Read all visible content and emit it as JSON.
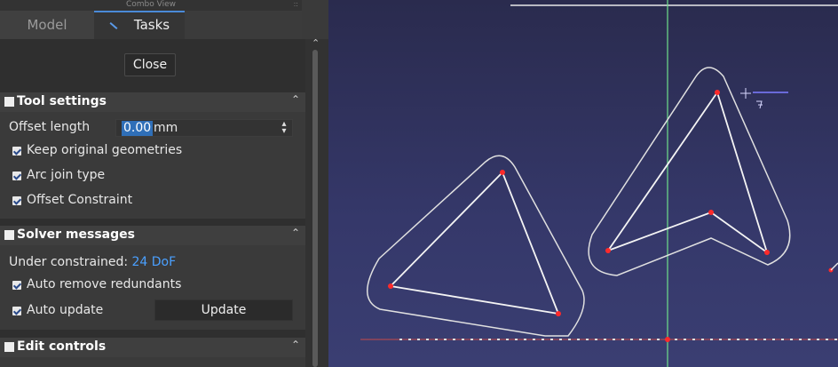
{
  "combo": {
    "title": "Combo View",
    "grip": "::"
  },
  "tabs": {
    "model": "Model",
    "tasks": "Tasks"
  },
  "close_label": "Close",
  "tool_settings": {
    "title": "Tool settings",
    "offset_label": "Offset length",
    "offset_value": "0.00",
    "offset_unit": "mm",
    "keep_original": "Keep original geometries",
    "arc_join": "Arc join type",
    "offset_constraint": "Offset Constraint"
  },
  "solver": {
    "title": "Solver messages",
    "status_label": "Under constrained:",
    "dof": "24 DoF",
    "auto_remove": "Auto remove redundants",
    "auto_update": "Auto update",
    "update_label": "Update"
  },
  "edit_controls": {
    "title": "Edit controls"
  },
  "icons": {
    "caret": "chevron-up-icon",
    "spin": "spin-arrows-icon"
  },
  "colors": {
    "accent": "#4a8ad8",
    "vertex": "#ff2a2a",
    "dof": "#4aa0ff"
  }
}
